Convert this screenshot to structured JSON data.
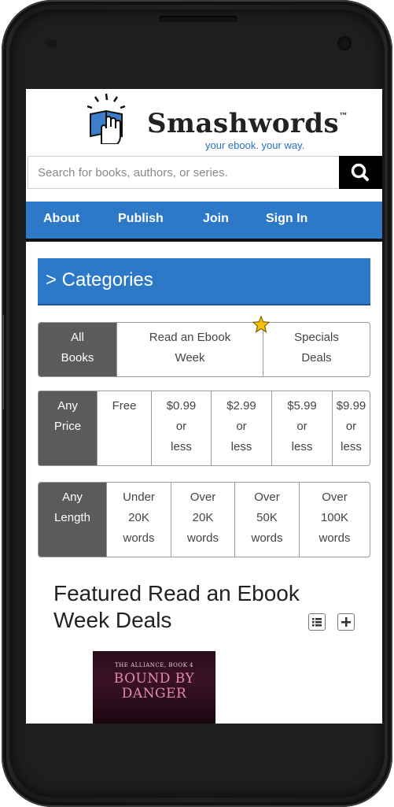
{
  "header": {
    "logo_text": "Smashwords",
    "logo_tm": "™",
    "tagline": "your ebook. your way."
  },
  "search": {
    "placeholder": "Search for books, authors, or series."
  },
  "nav": {
    "items": [
      "About",
      "Publish",
      "Join",
      "Sign In"
    ]
  },
  "categories": {
    "label": "> Categories"
  },
  "filters": {
    "type": {
      "options": [
        "All Books",
        "Read an Ebook Week",
        "Specials Deals"
      ],
      "selected": "All Books"
    },
    "price": {
      "options": [
        {
          "line1": "Any",
          "line2": "Price",
          "line3": ""
        },
        {
          "line1": "Free",
          "line2": "",
          "line3": ""
        },
        {
          "line1": "$0.99",
          "line2": "or",
          "line3": "less"
        },
        {
          "line1": "$2.99",
          "line2": "or",
          "line3": "less"
        },
        {
          "line1": "$5.99",
          "line2": "or",
          "line3": "less"
        },
        {
          "line1": "$9.99",
          "line2": "or",
          "line3": "less"
        }
      ],
      "selected": "Any Price"
    },
    "length": {
      "options": [
        {
          "line1": "Any",
          "line2": "Length",
          "line3": ""
        },
        {
          "line1": "Under",
          "line2": "20K",
          "line3": "words"
        },
        {
          "line1": "Over",
          "line2": "20K",
          "line3": "words"
        },
        {
          "line1": "Over",
          "line2": "50K",
          "line3": "words"
        },
        {
          "line1": "Over",
          "line2": "100K",
          "line3": "words"
        }
      ],
      "selected": "Any Length"
    }
  },
  "featured": {
    "title": "Featured Read an Ebook Week Deals",
    "book": {
      "series": "THE ALLIANCE, BOOK 4",
      "title": "BOUND BY DANGER"
    }
  },
  "icons": {
    "search": "search-icon",
    "list_view": "list-view-icon",
    "expand": "plus-icon",
    "promo": "star-icon"
  },
  "colors": {
    "brand_blue": "#2d79c7",
    "tagline_blue": "#2a6fc2",
    "active_filter": "#5b5b5b"
  }
}
